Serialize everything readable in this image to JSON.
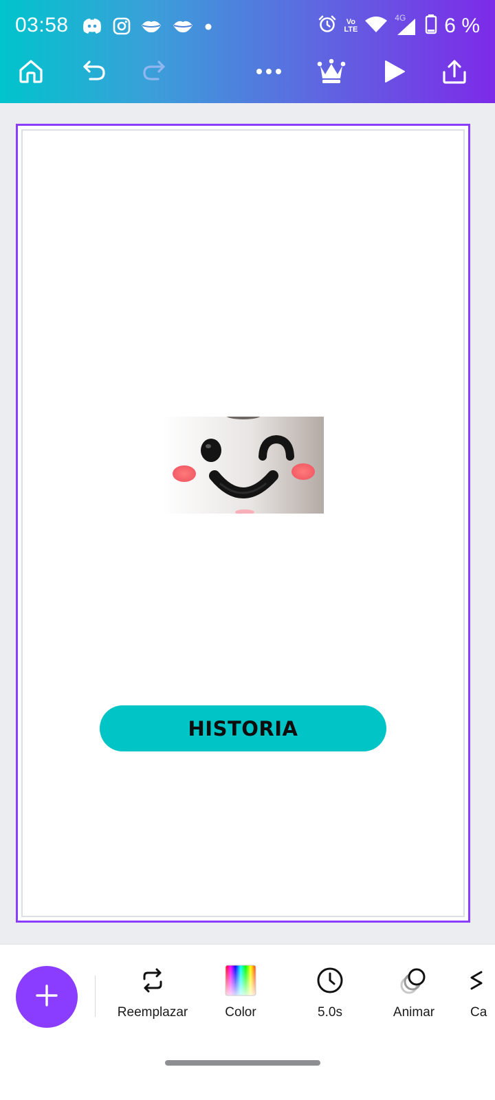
{
  "status_bar": {
    "time": "03:58",
    "battery_text": "6 %",
    "network_label": "4G",
    "volte_top": "Vo",
    "volte_bottom": "LTE",
    "left_icons": [
      "discord-icon",
      "instagram-icon",
      "lips-icon",
      "lips-icon",
      "dot-icon"
    ],
    "right_icons": [
      "alarm-icon",
      "volte-icon",
      "wifi-icon",
      "signal-icon",
      "battery-icon"
    ]
  },
  "toolbar": {
    "items": [
      "home-icon",
      "undo-icon",
      "redo-icon",
      "more-icon",
      "crown-icon",
      "play-icon",
      "share-icon"
    ]
  },
  "canvas": {
    "button_text": "HISTORIA",
    "button_color": "#00c4c6",
    "selection_color": "#8b3dff"
  },
  "bottom_panel": {
    "tools": [
      {
        "label": "Reemplazar",
        "icon": "replace-icon"
      },
      {
        "label": "Color",
        "icon": "color-swatch-icon"
      },
      {
        "label": "5.0s",
        "icon": "clock-icon"
      },
      {
        "label": "Animar",
        "icon": "animate-icon"
      },
      {
        "label": "Ca",
        "icon": "layers-icon"
      }
    ]
  },
  "colors": {
    "gradient_start": "#00c4cc",
    "gradient_end": "#7d2ae8",
    "accent": "#8b3dff"
  }
}
